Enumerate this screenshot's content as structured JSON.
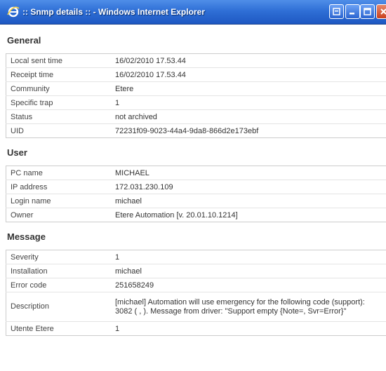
{
  "window": {
    "title": ":: Snmp details :: - Windows Internet Explorer",
    "accent_color": "#2f6fd6",
    "icons": [
      "ie-icon",
      "help-icon",
      "minimize-icon",
      "maximize-icon",
      "close-icon"
    ]
  },
  "sections": {
    "general": {
      "title": "General",
      "rows": [
        {
          "label": "Local sent time",
          "value": "16/02/2010 17.53.44"
        },
        {
          "label": "Receipt time",
          "value": "16/02/2010 17.53.44"
        },
        {
          "label": "Community",
          "value": "Etere"
        },
        {
          "label": "Specific trap",
          "value": "1"
        },
        {
          "label": "Status",
          "value": "not archived"
        },
        {
          "label": "UID",
          "value": "72231f09-9023-44a4-9da8-866d2e173ebf"
        }
      ]
    },
    "user": {
      "title": "User",
      "rows": [
        {
          "label": "PC name",
          "value": "MICHAEL"
        },
        {
          "label": "IP address",
          "value": "172.031.230.109"
        },
        {
          "label": "Login name",
          "value": "michael"
        },
        {
          "label": "Owner",
          "value": "Etere Automation [v. 20.01.10.1214]"
        }
      ]
    },
    "message": {
      "title": "Message",
      "rows": [
        {
          "label": "Severity",
          "value": "1"
        },
        {
          "label": "Installation",
          "value": "michael"
        },
        {
          "label": "Error code",
          "value": "251658249"
        },
        {
          "label": "Description",
          "value": "[michael] Automation will use emergency for the following code (support): 3082 ( , ). Message from driver: \"Support empty {Note=, Svr=Error}\""
        },
        {
          "label": "Utente Etere",
          "value": "1"
        }
      ]
    }
  }
}
